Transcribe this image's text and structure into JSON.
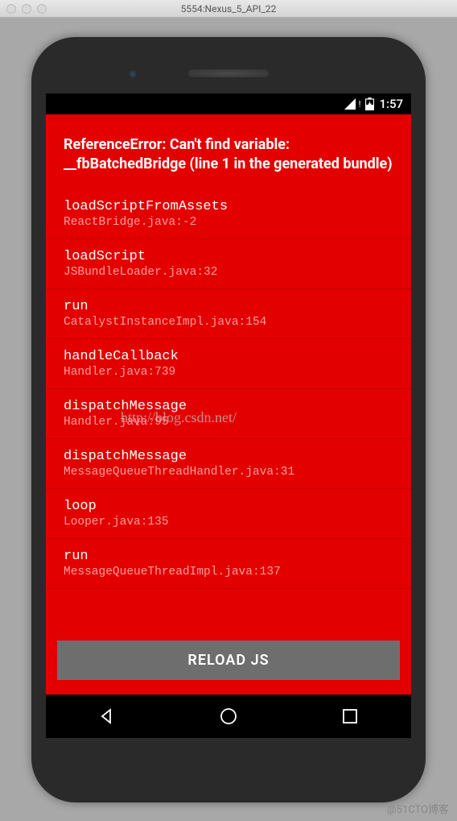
{
  "window": {
    "title": "5554:Nexus_5_API_22"
  },
  "statusBar": {
    "time": "1:57"
  },
  "error": {
    "title": "ReferenceError: Can't find variable: __fbBatchedBridge (line 1 in the generated bundle)",
    "stack": [
      {
        "method": "loadScriptFromAssets",
        "file": "ReactBridge.java:-2"
      },
      {
        "method": "loadScript",
        "file": "JSBundleLoader.java:32"
      },
      {
        "method": "run",
        "file": "CatalystInstanceImpl.java:154"
      },
      {
        "method": "handleCallback",
        "file": "Handler.java:739"
      },
      {
        "method": "dispatchMessage",
        "file": "Handler.java:95"
      },
      {
        "method": "dispatchMessage",
        "file": "MessageQueueThreadHandler.java:31"
      },
      {
        "method": "loop",
        "file": "Looper.java:135"
      },
      {
        "method": "run",
        "file": "MessageQueueThreadImpl.java:137"
      }
    ],
    "reloadLabel": "RELOAD JS"
  },
  "watermark": "http://blog.csdn.net/",
  "footerWatermark": "@51CTO博客"
}
